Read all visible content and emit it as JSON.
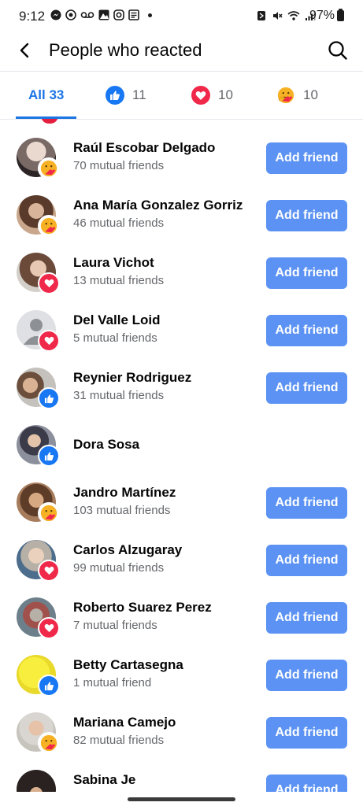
{
  "status": {
    "time": "9:12",
    "battery": "97%"
  },
  "header": {
    "title": "People who reacted"
  },
  "tabs": [
    {
      "label": "All 33",
      "icon": "none",
      "active": true
    },
    {
      "label": "11",
      "icon": "like-icon"
    },
    {
      "label": "10",
      "icon": "love-icon"
    },
    {
      "label": "10",
      "icon": "care-icon"
    }
  ],
  "people": [
    {
      "name": "Raúl Escobar Delgado",
      "mutual": "70 mutual friends",
      "reaction": "care",
      "button": "Add friend"
    },
    {
      "name": "Ana María Gonzalez Gorriz",
      "mutual": "46 mutual friends",
      "reaction": "care",
      "button": "Add friend"
    },
    {
      "name": "Laura Vichot",
      "mutual": "13 mutual friends",
      "reaction": "love",
      "button": "Add friend"
    },
    {
      "name": "Del Valle Loid",
      "mutual": "5 mutual friends",
      "reaction": "love",
      "button": "Add friend"
    },
    {
      "name": "Reynier Rodriguez",
      "mutual": "31 mutual friends",
      "reaction": "like",
      "button": "Add friend"
    },
    {
      "name": "Dora Sosa",
      "mutual": "",
      "reaction": "like",
      "button": ""
    },
    {
      "name": "Jandro Martínez",
      "mutual": "103 mutual friends",
      "reaction": "care",
      "button": "Add friend"
    },
    {
      "name": "Carlos Alzugaray",
      "mutual": "99 mutual friends",
      "reaction": "love",
      "button": "Add friend"
    },
    {
      "name": "Roberto Suarez Perez",
      "mutual": "7 mutual friends",
      "reaction": "love",
      "button": "Add friend"
    },
    {
      "name": "Betty Cartasegna",
      "mutual": "1 mutual friend",
      "reaction": "like",
      "button": "Add friend"
    },
    {
      "name": "Mariana Camejo",
      "mutual": "82 mutual friends",
      "reaction": "care",
      "button": "Add friend"
    },
    {
      "name": "Sabina Je",
      "mutual": "",
      "reaction": "none",
      "button": "Add friend"
    }
  ],
  "colors": {
    "accent": "#1b74e4",
    "button": "#5b92f3",
    "like": "#1877f2",
    "love": "#f0284a",
    "care": "#f7b125"
  }
}
